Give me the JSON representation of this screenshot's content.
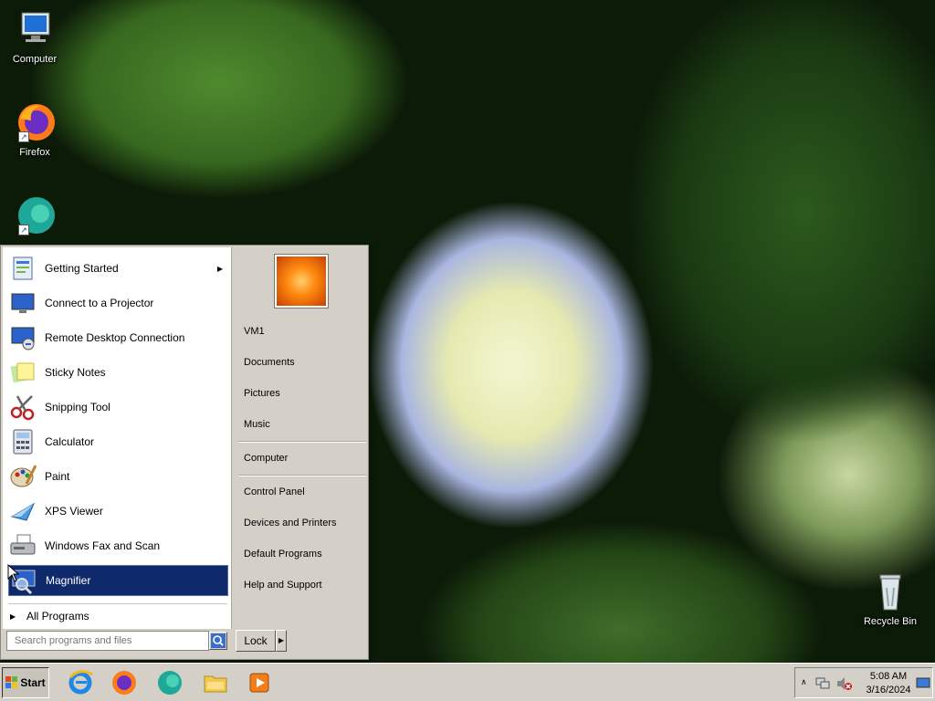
{
  "desktop": {
    "icons": [
      {
        "label": "Computer"
      },
      {
        "label": "Firefox"
      },
      {
        "label": "Recycle Bin"
      }
    ]
  },
  "start_menu": {
    "programs": [
      {
        "label": "Getting Started",
        "has_submenu": true
      },
      {
        "label": "Connect to a Projector"
      },
      {
        "label": "Remote Desktop Connection"
      },
      {
        "label": "Sticky Notes"
      },
      {
        "label": "Snipping Tool"
      },
      {
        "label": "Calculator"
      },
      {
        "label": "Paint"
      },
      {
        "label": "XPS Viewer"
      },
      {
        "label": "Windows Fax and Scan"
      },
      {
        "label": "Magnifier",
        "selected": true
      }
    ],
    "all_programs_label": "All Programs",
    "search_placeholder": "Search programs and files",
    "right_items": [
      {
        "label": "VM1"
      },
      {
        "label": "Documents"
      },
      {
        "label": "Pictures"
      },
      {
        "label": "Music"
      },
      {
        "label": "Computer"
      },
      {
        "label": "Control Panel"
      },
      {
        "label": "Devices and Printers"
      },
      {
        "label": "Default Programs"
      },
      {
        "label": "Help and Support"
      }
    ],
    "lock_label": "Lock"
  },
  "taskbar": {
    "start_label": "Start",
    "pinned": [
      {
        "icon": "internet-explorer-icon"
      },
      {
        "icon": "firefox-icon"
      },
      {
        "icon": "edge-icon"
      },
      {
        "icon": "file-explorer-icon"
      },
      {
        "icon": "media-player-icon"
      }
    ],
    "clock_time": "5:08 AM",
    "clock_date": "3/16/2024"
  }
}
